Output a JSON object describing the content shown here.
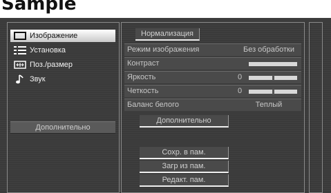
{
  "header": {
    "title": "Sample"
  },
  "left_menu": {
    "items": [
      {
        "label": "Изображение",
        "icon": "monitor-icon",
        "selected": true
      },
      {
        "label": "Установка",
        "icon": "list-icon",
        "selected": false
      },
      {
        "label": "Поз./размер",
        "icon": "position-size-icon",
        "selected": false
      },
      {
        "label": "Звук",
        "icon": "music-note-icon",
        "selected": false
      }
    ],
    "advanced_label": "Дополнительно"
  },
  "picture_menu": {
    "normalize_label": "Нормализация",
    "rows": [
      {
        "label": "Режим изображения",
        "value": "Без обработки"
      },
      {
        "label": "Контраст",
        "value": ""
      },
      {
        "label": "Яркость",
        "value": "0",
        "level": 0.5
      },
      {
        "label": "Четкость",
        "value": "0",
        "level": 0.5
      },
      {
        "label": "Баланс белого",
        "value": "Теплый"
      }
    ],
    "advanced_label": "Дополнительно",
    "save_label": "Сохр. в пам.",
    "load_label": "Загр из пам.",
    "edit_label": "Редакт. пам."
  },
  "colors": {
    "screen_bg": "#3a3a3a",
    "selected_bg": "#ffffff",
    "text": "#d0d0d0"
  }
}
